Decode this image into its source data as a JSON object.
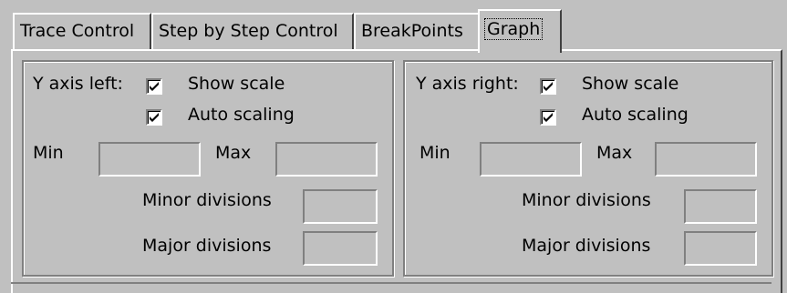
{
  "tabs": [
    {
      "label": "Trace Control",
      "active": false
    },
    {
      "label": "Step by Step Control",
      "active": false
    },
    {
      "label": "BreakPoints",
      "active": false
    },
    {
      "label": "Graph",
      "active": true
    }
  ],
  "left_axis": {
    "title": "Y axis left:",
    "show_scale": {
      "label": "Show scale",
      "checked": true
    },
    "auto_scaling": {
      "label": "Auto scaling",
      "checked": true
    },
    "min_label": "Min",
    "min_value": "",
    "max_label": "Max",
    "max_value": "",
    "minor_label": "Minor divisions",
    "minor_value": "",
    "major_label": "Major divisions",
    "major_value": ""
  },
  "right_axis": {
    "title": "Y axis right:",
    "show_scale": {
      "label": "Show scale",
      "checked": true
    },
    "auto_scaling": {
      "label": "Auto scaling",
      "checked": true
    },
    "min_label": "Min",
    "min_value": "",
    "max_label": "Max",
    "max_value": "",
    "minor_label": "Minor divisions",
    "minor_value": "",
    "major_label": "Major divisions",
    "major_value": ""
  },
  "colors": {
    "face": "#c0c0c0",
    "highlight": "#ffffff",
    "shadow": "#808080",
    "dark_shadow": "#404040"
  }
}
